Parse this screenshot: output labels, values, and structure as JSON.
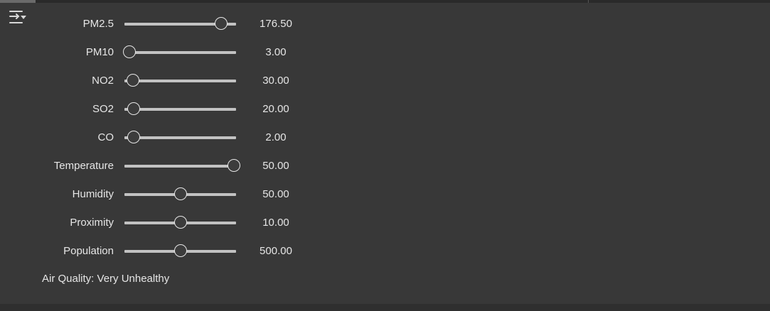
{
  "sliders": [
    {
      "label": "PM2.5",
      "value": "176.50",
      "fraction": 0.88
    },
    {
      "label": "PM10",
      "value": "3.00",
      "fraction": 0.02
    },
    {
      "label": "NO2",
      "value": "30.00",
      "fraction": 0.05
    },
    {
      "label": "SO2",
      "value": "20.00",
      "fraction": 0.06
    },
    {
      "label": "CO",
      "value": "2.00",
      "fraction": 0.06
    },
    {
      "label": "Temperature",
      "value": "50.00",
      "fraction": 1.0
    },
    {
      "label": "Humidity",
      "value": "50.00",
      "fraction": 0.5
    },
    {
      "label": "Proximity",
      "value": "10.00",
      "fraction": 0.5
    },
    {
      "label": "Population",
      "value": "500.00",
      "fraction": 0.5
    }
  ],
  "status": {
    "text": "Air Quality: Very Unhealthy"
  },
  "icons": {
    "toggle": "controls-toggle-icon"
  },
  "colors": {
    "background": "#383838",
    "track": "#c2c2c2",
    "text": "#e6e6e6"
  }
}
